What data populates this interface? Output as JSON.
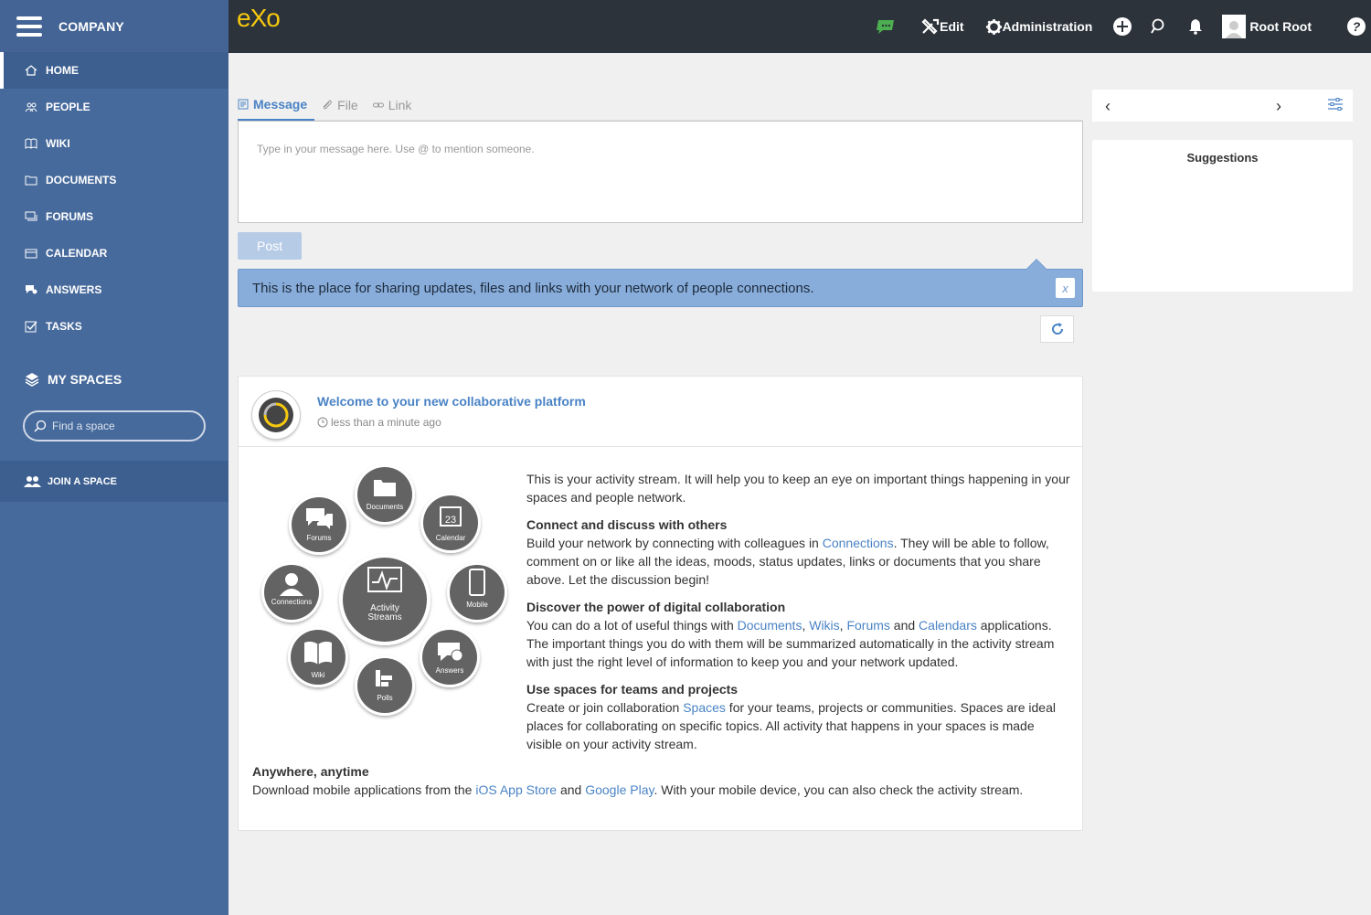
{
  "sidebar": {
    "company": "COMPANY",
    "nav": [
      {
        "label": "HOME",
        "icon": "home-icon"
      },
      {
        "label": "PEOPLE",
        "icon": "people-icon"
      },
      {
        "label": "WIKI",
        "icon": "book-icon"
      },
      {
        "label": "DOCUMENTS",
        "icon": "folder-icon"
      },
      {
        "label": "FORUMS",
        "icon": "forum-icon"
      },
      {
        "label": "CALENDAR",
        "icon": "calendar-icon"
      },
      {
        "label": "ANSWERS",
        "icon": "answers-icon"
      },
      {
        "label": "TASKS",
        "icon": "tasks-icon"
      }
    ],
    "my_spaces": "MY SPACES",
    "find_placeholder": "Find a space",
    "join_space": "JOIN A SPACE"
  },
  "topbar": {
    "logo": "eXo",
    "edit": "Edit",
    "administration": "Administration",
    "user": "Root Root",
    "chat_color": "#4caf50"
  },
  "composer": {
    "tabs": [
      "Message",
      "File",
      "Link"
    ],
    "placeholder": "Type in your message here. Use @ to mention someone.",
    "post": "Post",
    "tip": "This is the place for sharing updates, files and links with your network of people connections.",
    "tip_close": "x"
  },
  "activity": {
    "title": "Welcome to your new collaborative platform",
    "time": "less than a minute ago",
    "diagram": {
      "center": [
        "Activity",
        "Streams"
      ],
      "items": [
        "Documents",
        "Calendar",
        "Mobile",
        "Answers",
        "Polls",
        "Wiki",
        "Connections",
        "Forums"
      ]
    },
    "intro": "This is your activity stream. It will help you to keep an eye on important things happening in your spaces and people network.",
    "s1_title": "Connect and discuss with others",
    "s1_a": "Build your network by connecting with colleagues in ",
    "s1_link": "Connections",
    "s1_b": ". They will be able to follow, comment on or like all the ideas, moods, status updates, links or documents that you share above. Let the discussion begin!",
    "s2_title": "Discover the power of digital collaboration",
    "s2_a": "You can do a lot of useful things with ",
    "s2_l1": "Documents",
    "s2_c1": ", ",
    "s2_l2": "Wikis",
    "s2_c2": ", ",
    "s2_l3": "Forums",
    "s2_and": " and ",
    "s2_l4": "Calendars",
    "s2_b": " applications. The important things you do with them will be summarized automatically in the activity stream with just the right level of information to keep you and your network updated.",
    "s3_title": "Use spaces for teams and projects",
    "s3_a": "Create or join collaboration ",
    "s3_link": "Spaces",
    "s3_b": " for your teams, projects or communities. Spaces are ideal places for collaborating on specific topics. All activity that happens in your spaces is made visible on your activity stream.",
    "s4_title": "Anywhere, anytime",
    "s4_a": "Download mobile applications from the ",
    "s4_l1": "iOS App Store",
    "s4_and": " and ",
    "s4_l2": "Google Play",
    "s4_b": ". With your mobile device, you can also check the activity stream."
  },
  "right": {
    "prev": "‹",
    "next": "›",
    "suggestions": "Suggestions"
  }
}
